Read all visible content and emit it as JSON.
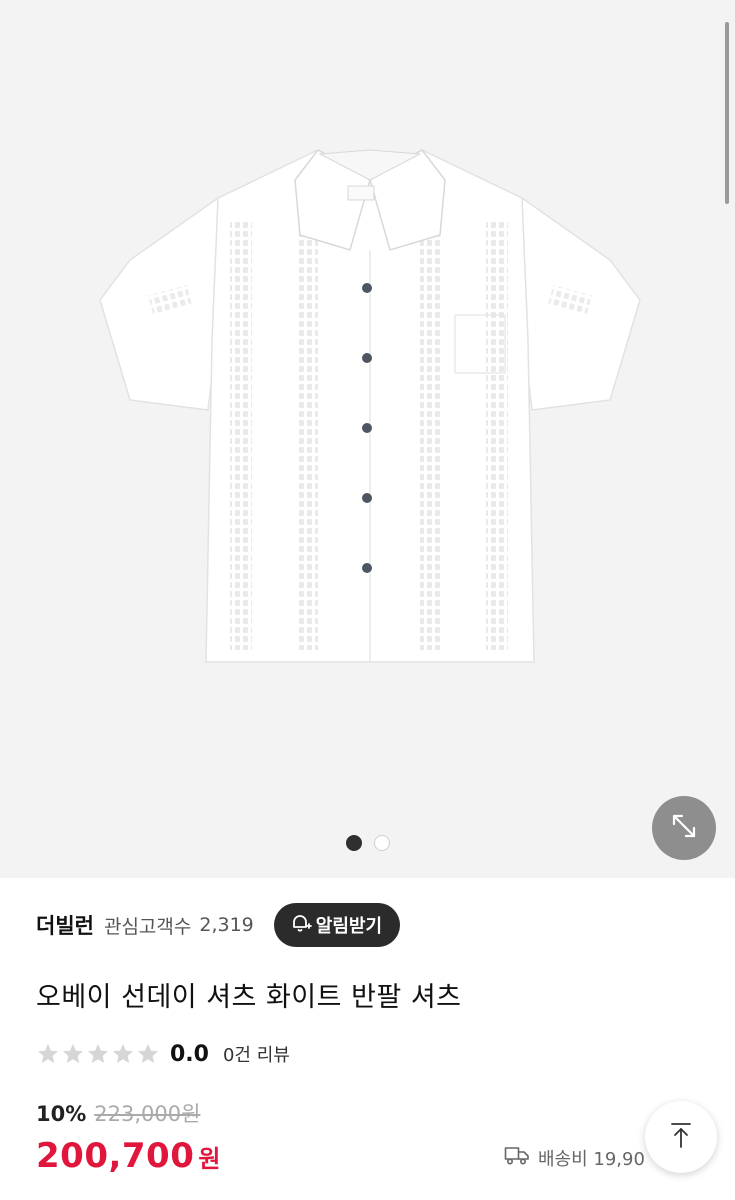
{
  "hero": {
    "total_images": 2,
    "active_index": 0
  },
  "brand": {
    "name": "더빌런",
    "followers_label": "관심고객수",
    "followers_count": "2,319",
    "alert_button_label": "알림받기"
  },
  "product": {
    "title": "오베이 선데이 셔츠 화이트 반팔 셔츠",
    "rating": {
      "stars_filled": 0,
      "stars_total": 5,
      "value": "0.0",
      "review_count": "0건 리뷰"
    },
    "discount_percent": "10%",
    "original_price": "223,000원",
    "price": "200,700",
    "currency": "원",
    "shipping_label": "배송비 19,90"
  },
  "icons": {
    "expand": "expand-icon",
    "scroll_top": "arrow-up-icon",
    "bell": "bell-plus-icon",
    "truck": "truck-icon",
    "star": "star-icon"
  },
  "colors": {
    "price_red": "#e0163c",
    "star_gray": "#d6d6d6",
    "alert_button_bg": "#2b2b2b"
  }
}
